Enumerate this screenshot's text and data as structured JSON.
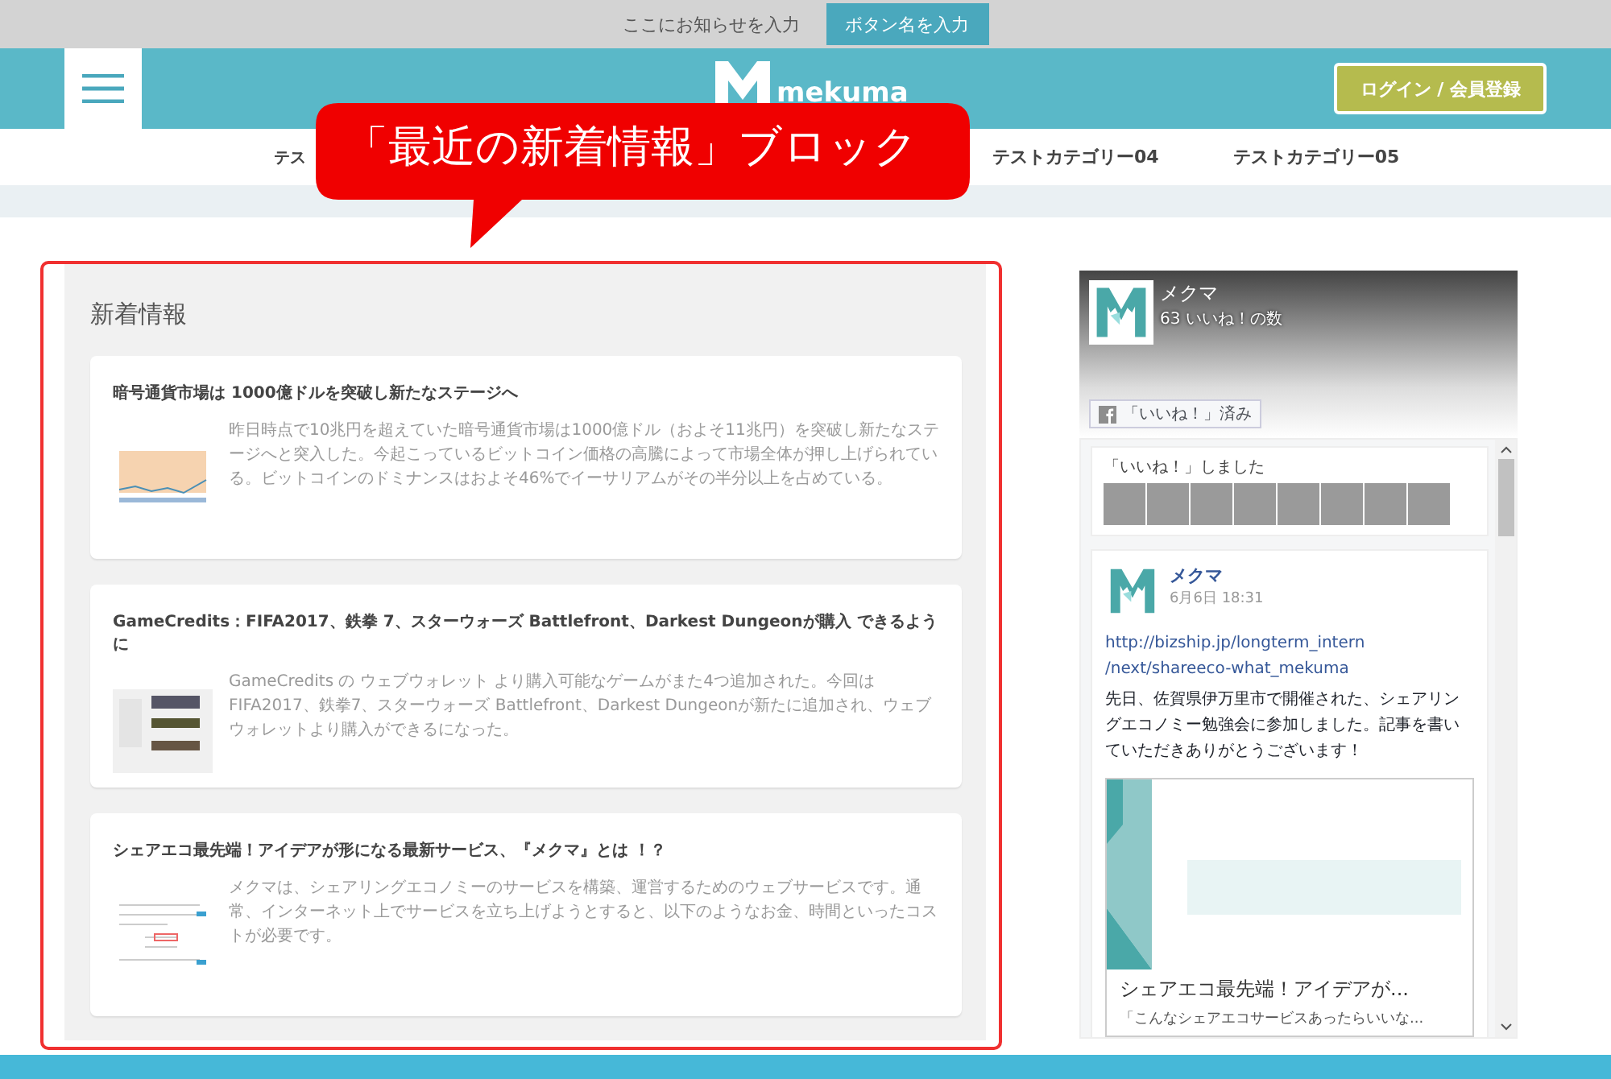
{
  "notice_bar": {
    "text": "ここにお知らせを入力",
    "button": "ボタン名を入力"
  },
  "header": {
    "logo_text": "mekuma",
    "login_button": "ログイン / 会員登録"
  },
  "nav": {
    "items": [
      {
        "label": "テス"
      },
      {
        "label": "テストカテゴリー04"
      },
      {
        "label": "テストカテゴリー05"
      }
    ]
  },
  "news_block": {
    "heading": "新着情報",
    "articles": [
      {
        "title": "暗号通貨市場は 1000億ドルを突破し新たなステージへ",
        "excerpt": "昨日時点で10兆円を超えていた暗号通貨市場は1000億ドル（およそ11兆円）を突破し新たなステージへと突入した。今起こっているビットコイン価格の高騰によって市場全体が押し上げられている。ビットコインのドミナンスはおよそ46%でイーサリアムがその半分以上を占めている。"
      },
      {
        "title": "GameCredits：FIFA2017、鉄拳 7、スターウォーズ Battlefront、Darkest Dungeonが購入 できるように",
        "excerpt": "GameCredits の ウェブウォレット より購入可能なゲームがまた4つ追加された。今回はFIFA2017、鉄拳7、スターウォーズ Battlefront、Darkest Dungeonが新たに追加され、ウェブウォレットより購入ができるになった。"
      },
      {
        "title": "シェアエコ最先端！アイデアが形になる最新サービス、『メクマ』とは ！？",
        "excerpt": "メクマは、シェアリングエコノミーのサービスを構築、運営するためのウェブサービスです。通常、インターネット上でサービスを立ち上げようとすると、以下のようなお金、時間といったコストが必要です。"
      }
    ]
  },
  "facebook_widget": {
    "page_name": "メクマ",
    "like_count": "63 いいね！の数",
    "liked_button": "「いいね！」済み",
    "liked_label": "「いいね！」しました",
    "post": {
      "author": "メクマ",
      "time": "6月6日 18:31",
      "url_lines": [
        "http://bizship.jp/longterm_intern",
        "/next/shareeco-what_mekuma"
      ],
      "text": "先日、佐賀県伊万里市で開催された、シェアリングエコノミー勉強会に参加しました。記事を書いていただきありがとうございます！",
      "preview_title": "シェアエコ最先端！アイデアが...",
      "preview_desc": "「こんなシェアエコサービスあったらいいな..."
    }
  },
  "annotation": {
    "callout": "「最近の新着情報」ブロック"
  }
}
